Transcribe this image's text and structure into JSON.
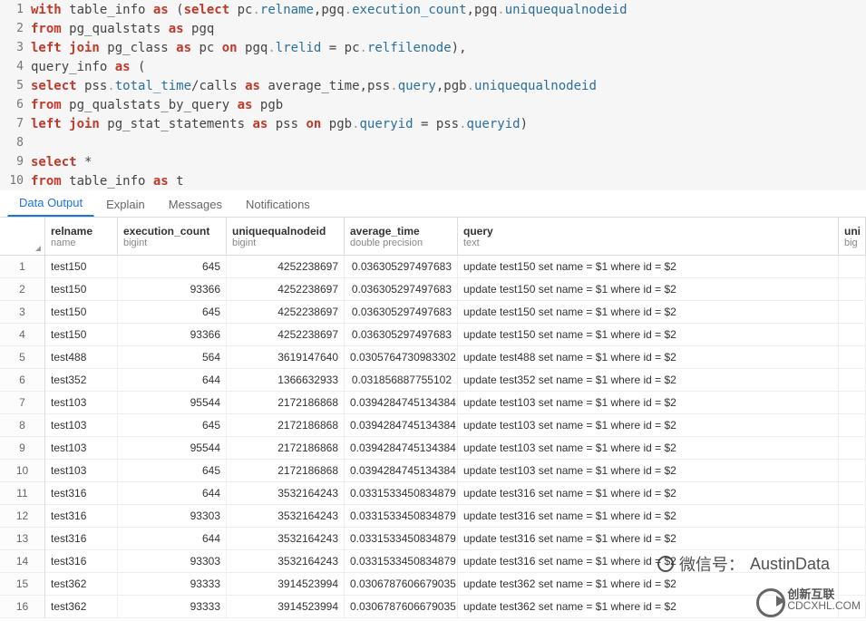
{
  "code": [
    [
      {
        "t": "with ",
        "c": "kw"
      },
      {
        "t": "table_info ",
        "c": "pn"
      },
      {
        "t": "as",
        "c": "kw"
      },
      {
        "t": " (",
        "c": "pn"
      },
      {
        "t": "select ",
        "c": "kw"
      },
      {
        "t": "pc",
        "c": "pn"
      },
      {
        "t": ".",
        "c": "gray"
      },
      {
        "t": "relname",
        "c": "id"
      },
      {
        "t": ",",
        "c": "pn"
      },
      {
        "t": "pgq",
        "c": "pn"
      },
      {
        "t": ".",
        "c": "gray"
      },
      {
        "t": "execution_count",
        "c": "id"
      },
      {
        "t": ",",
        "c": "pn"
      },
      {
        "t": "pgq",
        "c": "pn"
      },
      {
        "t": ".",
        "c": "gray"
      },
      {
        "t": "uniquequalnodeid",
        "c": "id"
      }
    ],
    [
      {
        "t": "from ",
        "c": "kw"
      },
      {
        "t": "pg_qualstats ",
        "c": "pn"
      },
      {
        "t": "as ",
        "c": "kw"
      },
      {
        "t": "pgq",
        "c": "pn"
      }
    ],
    [
      {
        "t": "left join ",
        "c": "kw"
      },
      {
        "t": "pg_class ",
        "c": "pn"
      },
      {
        "t": "as ",
        "c": "kw"
      },
      {
        "t": "pc ",
        "c": "pn"
      },
      {
        "t": "on ",
        "c": "kw"
      },
      {
        "t": "pgq",
        "c": "pn"
      },
      {
        "t": ".",
        "c": "gray"
      },
      {
        "t": "lrelid",
        "c": "id"
      },
      {
        "t": " = ",
        "c": "pn"
      },
      {
        "t": "pc",
        "c": "pn"
      },
      {
        "t": ".",
        "c": "gray"
      },
      {
        "t": "relfilenode",
        "c": "id"
      },
      {
        "t": "),",
        "c": "pn"
      }
    ],
    [
      {
        "t": "query_info ",
        "c": "pn"
      },
      {
        "t": "as",
        "c": "kw"
      },
      {
        "t": " (",
        "c": "pn"
      }
    ],
    [
      {
        "t": "select ",
        "c": "kw"
      },
      {
        "t": "pss",
        "c": "pn"
      },
      {
        "t": ".",
        "c": "gray"
      },
      {
        "t": "total_time",
        "c": "id"
      },
      {
        "t": "/calls ",
        "c": "pn"
      },
      {
        "t": "as ",
        "c": "kw"
      },
      {
        "t": "average_time",
        "c": "pn"
      },
      {
        "t": ",",
        "c": "pn"
      },
      {
        "t": "pss",
        "c": "pn"
      },
      {
        "t": ".",
        "c": "gray"
      },
      {
        "t": "query",
        "c": "id"
      },
      {
        "t": ",",
        "c": "pn"
      },
      {
        "t": "pgb",
        "c": "pn"
      },
      {
        "t": ".",
        "c": "gray"
      },
      {
        "t": "uniquequalnodeid",
        "c": "id"
      }
    ],
    [
      {
        "t": "from ",
        "c": "kw"
      },
      {
        "t": "pg_qualstats_by_query ",
        "c": "pn"
      },
      {
        "t": "as ",
        "c": "kw"
      },
      {
        "t": "pgb",
        "c": "pn"
      }
    ],
    [
      {
        "t": "left join ",
        "c": "kw"
      },
      {
        "t": "pg_stat_statements ",
        "c": "pn"
      },
      {
        "t": "as ",
        "c": "kw"
      },
      {
        "t": "pss ",
        "c": "pn"
      },
      {
        "t": "on ",
        "c": "kw"
      },
      {
        "t": "pgb",
        "c": "pn"
      },
      {
        "t": ".",
        "c": "gray"
      },
      {
        "t": "queryid",
        "c": "id"
      },
      {
        "t": " = ",
        "c": "pn"
      },
      {
        "t": "pss",
        "c": "pn"
      },
      {
        "t": ".",
        "c": "gray"
      },
      {
        "t": "queryid",
        "c": "id"
      },
      {
        "t": ")",
        "c": "pn"
      }
    ],
    [
      {
        "t": "",
        "c": "pn"
      }
    ],
    [
      {
        "t": "select",
        "c": "kw"
      },
      {
        "t": " *",
        "c": "pn"
      }
    ],
    [
      {
        "t": "from ",
        "c": "kw"
      },
      {
        "t": "table_info ",
        "c": "pn"
      },
      {
        "t": "as ",
        "c": "kw"
      },
      {
        "t": "t",
        "c": "pn"
      }
    ]
  ],
  "tabs": {
    "data_output": "Data Output",
    "explain": "Explain",
    "messages": "Messages",
    "notifications": "Notifications"
  },
  "columns": [
    {
      "name": "relname",
      "type": "name"
    },
    {
      "name": "execution_count",
      "type": "bigint"
    },
    {
      "name": "uniquequalnodeid",
      "type": "bigint"
    },
    {
      "name": "average_time",
      "type": "double precision"
    },
    {
      "name": "query",
      "type": "text"
    },
    {
      "name": "uni",
      "type": "big"
    }
  ],
  "rows": [
    [
      "test150",
      "645",
      "4252238697",
      "0.036305297497683",
      "update test150 set name = $1 where id = $2"
    ],
    [
      "test150",
      "93366",
      "4252238697",
      "0.036305297497683",
      "update test150 set name = $1 where id = $2"
    ],
    [
      "test150",
      "645",
      "4252238697",
      "0.036305297497683",
      "update test150 set name = $1 where id = $2"
    ],
    [
      "test150",
      "93366",
      "4252238697",
      "0.036305297497683",
      "update test150 set name = $1 where id = $2"
    ],
    [
      "test488",
      "564",
      "3619147640",
      "0.0305764730983302",
      "update test488 set name = $1 where id = $2"
    ],
    [
      "test352",
      "644",
      "1366632933",
      "0.031856887755102",
      "update test352 set name = $1 where id = $2"
    ],
    [
      "test103",
      "95544",
      "2172186868",
      "0.0394284745134384",
      "update test103 set name = $1 where id = $2"
    ],
    [
      "test103",
      "645",
      "2172186868",
      "0.0394284745134384",
      "update test103 set name = $1 where id = $2"
    ],
    [
      "test103",
      "95544",
      "2172186868",
      "0.0394284745134384",
      "update test103 set name = $1 where id = $2"
    ],
    [
      "test103",
      "645",
      "2172186868",
      "0.0394284745134384",
      "update test103 set name = $1 where id = $2"
    ],
    [
      "test316",
      "644",
      "3532164243",
      "0.0331533450834879",
      "update test316 set name = $1 where id = $2"
    ],
    [
      "test316",
      "93303",
      "3532164243",
      "0.0331533450834879",
      "update test316 set name = $1 where id = $2"
    ],
    [
      "test316",
      "644",
      "3532164243",
      "0.0331533450834879",
      "update test316 set name = $1 where id = $2"
    ],
    [
      "test316",
      "93303",
      "3532164243",
      "0.0331533450834879",
      "update test316 set name = $1 where id = $2"
    ],
    [
      "test362",
      "93333",
      "3914523994",
      "0.0306787606679035",
      "update test362 set name = $1 where id = $2"
    ],
    [
      "test362",
      "93333",
      "3914523994",
      "0.0306787606679035",
      "update test362 set name = $1 where id = $2"
    ]
  ],
  "watermark": {
    "prefix": "微信号：",
    "name": "AustinData"
  },
  "logo": {
    "cn": "创新互联",
    "en": "CDCXHL.COM"
  }
}
